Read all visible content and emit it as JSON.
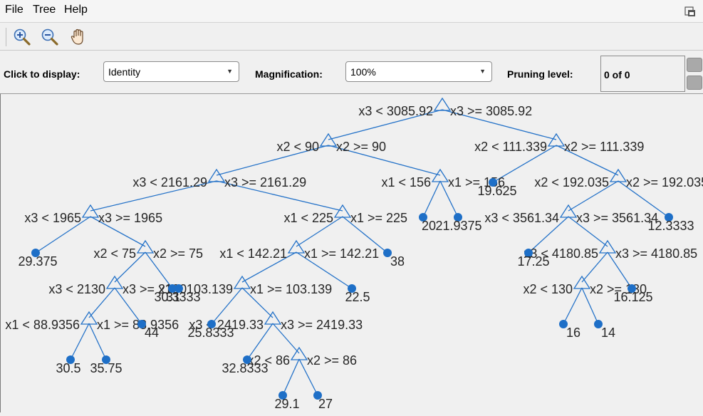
{
  "menu": {
    "file": "File",
    "tree": "Tree",
    "help": "Help"
  },
  "controls": {
    "display_label": "Click to display:",
    "display_value": "Identity",
    "magnification_label": "Magnification:",
    "magnification_value": "100%",
    "pruning_label": "Pruning level:",
    "pruning_value": "0 of 0"
  },
  "colors": {
    "branch": "#2472c8",
    "leaf": "#1e6fc7",
    "text": "#262626"
  },
  "tree": {
    "nodes": [
      {
        "id": "n1",
        "left": "x3 < 3085.92",
        "right": "x3 >= 3085.92"
      },
      {
        "id": "n2",
        "left": "x2 < 90",
        "right": "x2 >= 90"
      },
      {
        "id": "n3",
        "left": "x2 < 111.339",
        "right": "x2 >= 111.339"
      },
      {
        "id": "n4",
        "left": "x3 < 2161.29",
        "right": "x3 >= 2161.29"
      },
      {
        "id": "n5",
        "left": "x1 < 156",
        "right": "x1 >= 156"
      },
      {
        "id": "n6",
        "left": "x2 < 192.035",
        "right": "x2 >= 192.035"
      },
      {
        "id": "n7",
        "left": "x3 < 1965",
        "right": "x3 >= 1965"
      },
      {
        "id": "n8",
        "left": "x1 < 225",
        "right": "x1 >= 225"
      },
      {
        "id": "n9",
        "left": "x3 < 3561.34",
        "right": "x3 >= 3561.34"
      },
      {
        "id": "n10",
        "left": "x2 < 75",
        "right": "x2 >= 75"
      },
      {
        "id": "n11",
        "left": "x1 < 142.21",
        "right": "x1 >= 142.21"
      },
      {
        "id": "n12",
        "left": "x3 < 4180.85",
        "right": "x3 >= 4180.85"
      },
      {
        "id": "n13",
        "left": "x3 < 2130",
        "right": "x3 >= 2130"
      },
      {
        "id": "n14",
        "left": "x1 < 103.139",
        "right": "x1 >= 103.139"
      },
      {
        "id": "n15",
        "left": "x2 < 130",
        "right": "x2 >= 130"
      },
      {
        "id": "n16",
        "left": "x1 < 88.9356",
        "right": "x1 >= 88.9356"
      },
      {
        "id": "n17",
        "left": "x3 < 2419.33",
        "right": "x3 >= 2419.33"
      },
      {
        "id": "n18",
        "left": "x2 < 86",
        "right": "x2 >= 86"
      }
    ],
    "leaves": [
      "19.625",
      "20",
      "21.9375",
      "12.3333",
      "29.375",
      "38",
      "17.25",
      "31",
      "30.3333",
      "22.5",
      "16.125",
      "44",
      "25.8333",
      "16",
      "14",
      "30.5",
      "35.75",
      "32.8333",
      "29.1",
      "27"
    ]
  }
}
